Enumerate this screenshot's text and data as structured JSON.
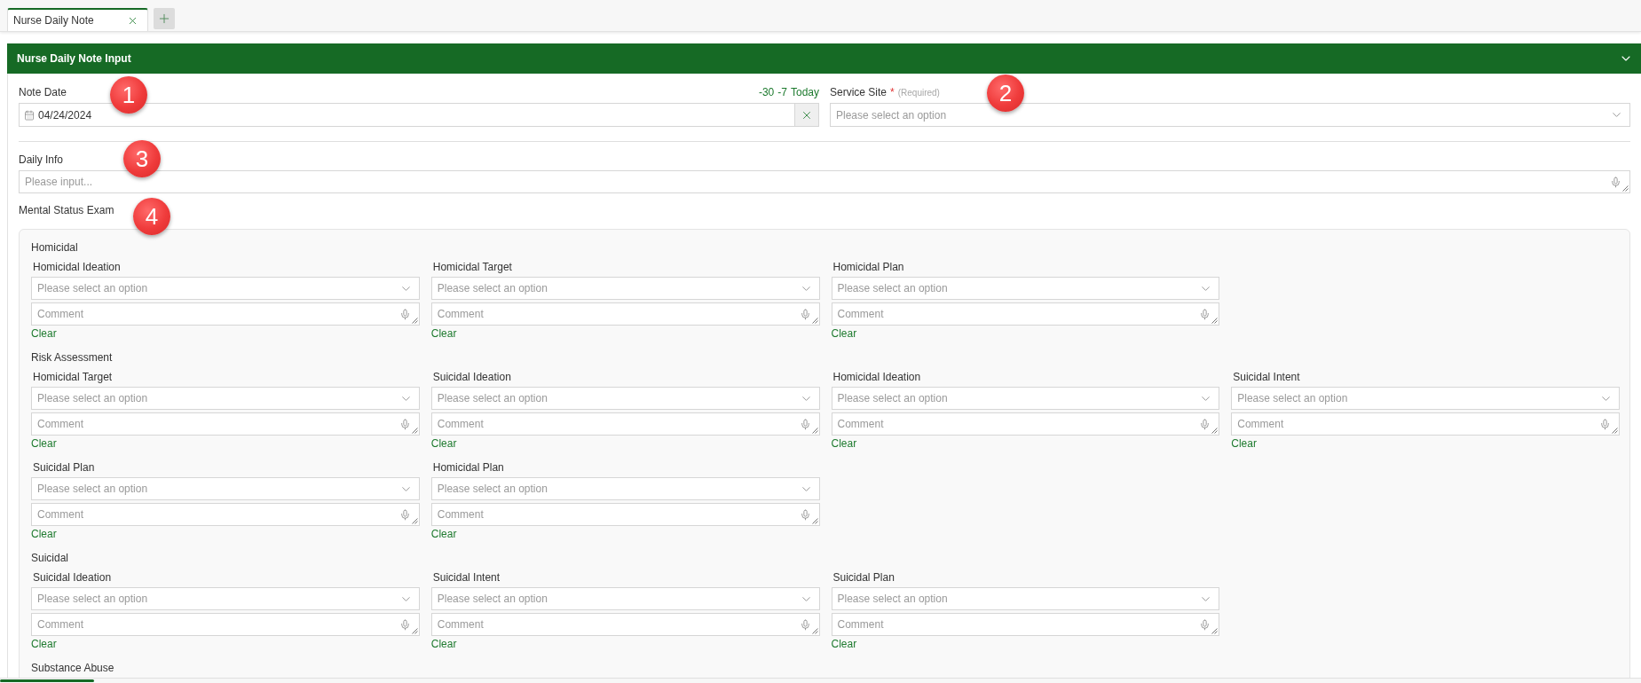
{
  "tabs": [
    {
      "label": "Nurse Daily Note",
      "selected": true
    }
  ],
  "panel": {
    "title": "Nurse Daily Note Input",
    "expanded": true
  },
  "note_date": {
    "label": "Note Date",
    "annotation": "1",
    "value": "04/24/2024",
    "shortcuts": [
      "-30",
      "-7",
      "Today"
    ]
  },
  "service_site": {
    "label": "Service Site",
    "required_mark": "*",
    "required_hint": "(Required)",
    "annotation": "2",
    "placeholder": "Please select an option"
  },
  "daily_info": {
    "label": "Daily Info",
    "annotation": "3",
    "placeholder": "Please input..."
  },
  "mental_status_exam": {
    "title": "Mental Status Exam",
    "annotation": "4",
    "groups": [
      {
        "title": "Homicidal",
        "fields": [
          {
            "label": "Homicidal Ideation",
            "placeholder": "Please select an option",
            "comment_placeholder": "Comment",
            "clear": "Clear"
          },
          {
            "label": "Homicidal Target",
            "placeholder": "Please select an option",
            "comment_placeholder": "Comment",
            "clear": "Clear"
          },
          {
            "label": "Homicidal Plan",
            "placeholder": "Please select an option",
            "comment_placeholder": "Comment",
            "clear": "Clear"
          }
        ]
      },
      {
        "title": "Risk Assessment",
        "fields": [
          {
            "label": "Homicidal Target",
            "placeholder": "Please select an option",
            "comment_placeholder": "Comment",
            "clear": "Clear"
          },
          {
            "label": "Suicidal Ideation",
            "placeholder": "Please select an option",
            "comment_placeholder": "Comment",
            "clear": "Clear"
          },
          {
            "label": "Homicidal Ideation",
            "placeholder": "Please select an option",
            "comment_placeholder": "Comment",
            "clear": "Clear"
          },
          {
            "label": "Suicidal Intent",
            "placeholder": "Please select an option",
            "comment_placeholder": "Comment",
            "clear": "Clear"
          },
          {
            "label": "Suicidal Plan",
            "placeholder": "Please select an option",
            "comment_placeholder": "Comment",
            "clear": "Clear"
          },
          {
            "label": "Homicidal Plan",
            "placeholder": "Please select an option",
            "comment_placeholder": "Comment",
            "clear": "Clear"
          }
        ]
      },
      {
        "title": "Suicidal",
        "fields": [
          {
            "label": "Suicidal Ideation",
            "placeholder": "Please select an option",
            "comment_placeholder": "Comment",
            "clear": "Clear"
          },
          {
            "label": "Suicidal Intent",
            "placeholder": "Please select an option",
            "comment_placeholder": "Comment",
            "clear": "Clear"
          },
          {
            "label": "Suicidal Plan",
            "placeholder": "Please select an option",
            "comment_placeholder": "Comment",
            "clear": "Clear"
          }
        ]
      },
      {
        "title": "Substance Abuse"
      }
    ]
  }
}
